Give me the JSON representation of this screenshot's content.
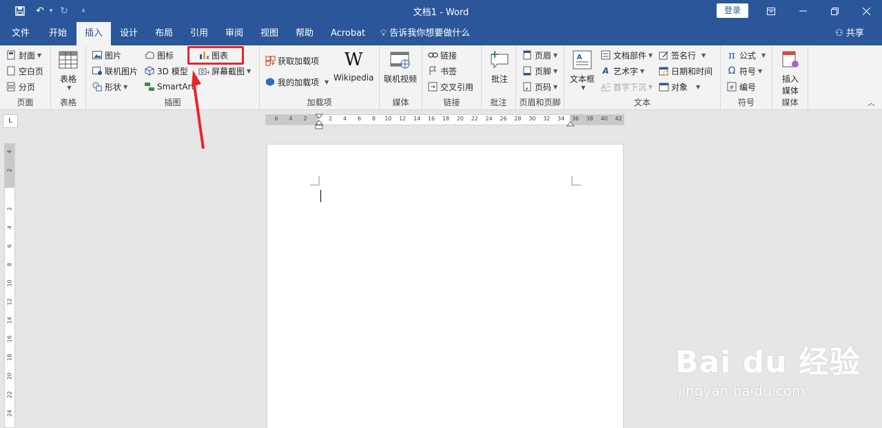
{
  "titlebar": {
    "title": "文档1  -  Word",
    "login": "登录"
  },
  "tabs": [
    "文件",
    "开始",
    "插入",
    "设计",
    "布局",
    "引用",
    "审阅",
    "视图",
    "帮助",
    "Acrobat"
  ],
  "active_tab": "插入",
  "tell_me": "告诉我你想要做什么",
  "share": "共享",
  "ribbon": {
    "pages": {
      "cover": "封面",
      "blank": "空白页",
      "break": "分页",
      "label": "页面"
    },
    "tables": {
      "table": "表格",
      "label": "表格"
    },
    "illustrations": {
      "picture": "图片",
      "online_picture": "联机图片",
      "shapes": "形状",
      "icons": "图标",
      "model3d": "3D 模型",
      "smartart": "SmartArt",
      "chart": "图表",
      "screenshot": "屏幕截图",
      "label": "插图"
    },
    "addins": {
      "get": "获取加载项",
      "my": "我的加载项",
      "wikipedia": "Wikipedia",
      "label": "加载项"
    },
    "media": {
      "online_video": "联机视频",
      "label": "媒体"
    },
    "links": {
      "link": "链接",
      "bookmark": "书签",
      "crossref": "交叉引用",
      "label": "链接"
    },
    "comments": {
      "comment": "批注",
      "label": "批注"
    },
    "header_footer": {
      "header": "页眉",
      "footer": "页脚",
      "page_number": "页码",
      "label": "页眉和页脚"
    },
    "text": {
      "textbox": "文本框",
      "quick_parts": "文档部件",
      "wordart": "艺术字",
      "dropcap": "首字下沉",
      "signature": "签名行",
      "datetime": "日期和时间",
      "object": "对象",
      "label": "文本"
    },
    "symbols": {
      "equation": "公式",
      "symbol": "符号",
      "number": "编号",
      "label": "符号"
    },
    "insert_media": {
      "insert": "插入",
      "media": "媒体",
      "label": "媒体"
    }
  },
  "ruler": {
    "corner": "L",
    "h_ticks": [
      "6",
      "4",
      "2",
      "2",
      "4",
      "6",
      "8",
      "10",
      "12",
      "14",
      "16",
      "18",
      "20",
      "22",
      "24",
      "26",
      "28",
      "30",
      "32",
      "34",
      "36",
      "38",
      "40",
      "42"
    ],
    "v_ticks": [
      "4",
      "2",
      "2",
      "4",
      "6",
      "8",
      "10",
      "12",
      "14",
      "16",
      "18",
      "20",
      "22",
      "24"
    ]
  },
  "watermark": {
    "main": "Bai du 经验",
    "sub": "jingyan.baidu.com"
  },
  "colors": {
    "accent": "#2b579a",
    "highlight": "#e8242b"
  }
}
